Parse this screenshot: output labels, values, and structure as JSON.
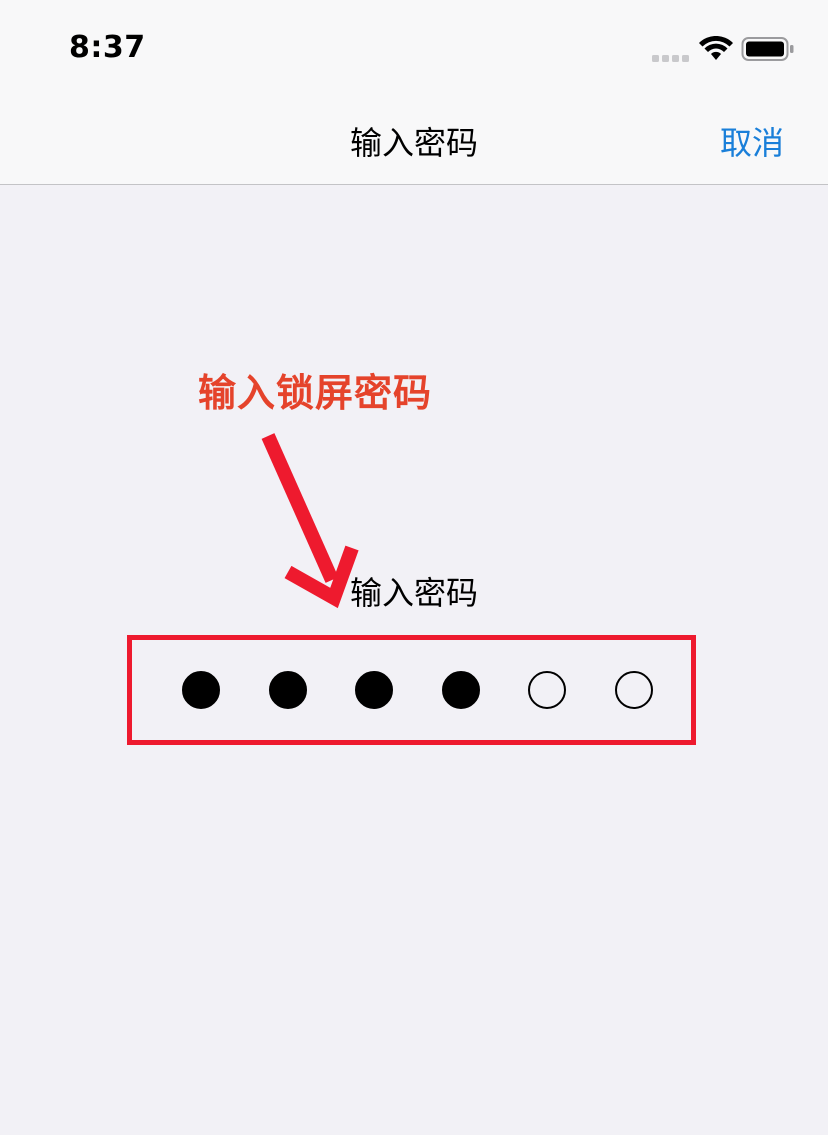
{
  "status_bar": {
    "time": "8:37"
  },
  "nav": {
    "title": "输入密码",
    "cancel_label": "取消"
  },
  "annotation": {
    "label": "输入锁屏密码",
    "color": "#e5432b",
    "box_color": "#ee1a2e"
  },
  "passcode": {
    "prompt": "输入密码",
    "length": 6,
    "entered": 4
  },
  "colors": {
    "accent": "#1a7fd9",
    "background": "#f2f1f6"
  }
}
